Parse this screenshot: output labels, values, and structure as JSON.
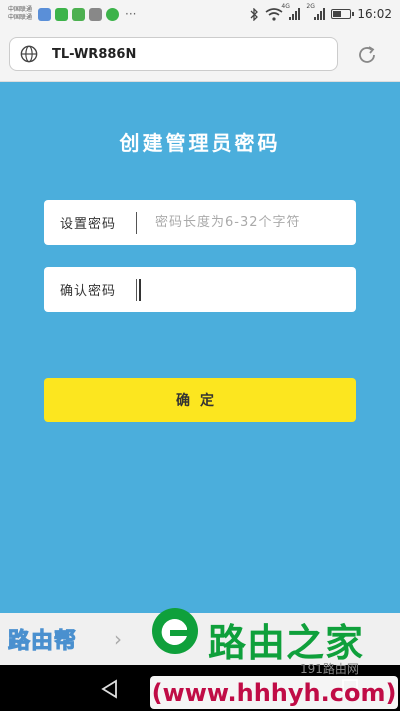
{
  "status_bar": {
    "carrier_1": "中国联通",
    "carrier_2": "中国联通",
    "notification_colors": [
      "#5a8fd8",
      "#3cb34a",
      "#4cb050",
      "#888888",
      "#3cb34a"
    ],
    "signal_1_label": "4G",
    "signal_2_label": "2G",
    "battery_level": 0.45,
    "time": "16:02"
  },
  "browser": {
    "url": "TL-WR886N"
  },
  "page": {
    "title": "创建管理员密码",
    "password_label": "设置密码",
    "password_placeholder": "密码长度为6-32个字符",
    "confirm_label": "确认密码",
    "confirm_value": "",
    "submit_label": "确定"
  },
  "footer": {
    "brand_text": "路由帮"
  },
  "watermark": {
    "name": "路由之家",
    "sub": "191路由网",
    "url": "(www.hhhyh.com)"
  },
  "colors": {
    "page_bg": "#4baedc",
    "button_bg": "#fce61f",
    "watermark_green": "#0fa03b",
    "watermark_url": "#c00c46"
  }
}
